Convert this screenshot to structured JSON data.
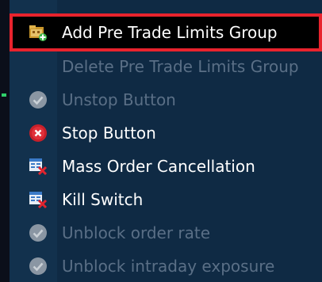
{
  "menu": {
    "items": [
      {
        "label": "Add Pre Trade Limits Group",
        "icon": "folder-add-icon",
        "enabled": true,
        "selected": true
      },
      {
        "label": "Delete Pre Trade Limits Group",
        "icon": "",
        "enabled": false,
        "selected": false
      },
      {
        "label": "Unstop Button",
        "icon": "check-circle-icon",
        "enabled": false,
        "selected": false
      },
      {
        "label": "Stop Button",
        "icon": "stop-x-icon",
        "enabled": true,
        "selected": false
      },
      {
        "label": "Mass Order Cancellation",
        "icon": "table-cancel-icon",
        "enabled": true,
        "selected": false
      },
      {
        "label": "Kill Switch",
        "icon": "table-cancel-icon",
        "enabled": true,
        "selected": false
      },
      {
        "label": "Unblock order rate",
        "icon": "check-circle-icon",
        "enabled": false,
        "selected": false
      },
      {
        "label": "Unblock intraday exposure",
        "icon": "check-circle-icon",
        "enabled": false,
        "selected": false
      }
    ]
  },
  "colors": {
    "menu_background": "#0f2a44",
    "selection_border": "#e8232d",
    "selected_background": "#000000",
    "enabled_text": "#ffffff",
    "disabled_text": "#5a6f86"
  }
}
